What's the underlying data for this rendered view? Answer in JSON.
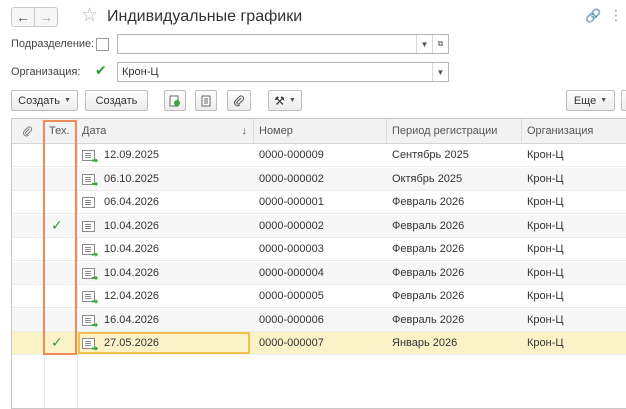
{
  "header": {
    "title": "Индивидуальные графики",
    "back_icon": "←",
    "forward_icon": "→",
    "star_icon": "☆",
    "link_icon": "🔗",
    "more_icon": "⋮"
  },
  "filters": {
    "department_label": "Подразделение:",
    "department_value": "",
    "organization_label": "Организация:",
    "organization_value": "Крон-Ц"
  },
  "toolbar": {
    "create_dropdown_label": "Создать",
    "create_button_label": "Создать",
    "more_label": "Еще"
  },
  "table": {
    "columns": [
      "Тех.",
      "Дата",
      "Номер",
      "Период регистрации",
      "Организация"
    ],
    "sort_indicator": "↓",
    "rows": [
      {
        "tech": "",
        "date": "12.09.2025",
        "number": "0000-000009",
        "period": "Сентябрь 2025",
        "org": "Крон-Ц",
        "posted": true
      },
      {
        "tech": "",
        "date": "06.10.2025",
        "number": "0000-000002",
        "period": "Октябрь 2025",
        "org": "Крон-Ц",
        "posted": true
      },
      {
        "tech": "",
        "date": "06.04.2026",
        "number": "0000-000001",
        "period": "Февраль 2026",
        "org": "Крон-Ц",
        "posted": false
      },
      {
        "tech": "✓",
        "date": "10.04.2026",
        "number": "0000-000002",
        "period": "Февраль 2026",
        "org": "Крон-Ц",
        "posted": false
      },
      {
        "tech": "",
        "date": "10.04.2026",
        "number": "0000-000003",
        "period": "Февраль 2026",
        "org": "Крон-Ц",
        "posted": true
      },
      {
        "tech": "",
        "date": "10.04.2026",
        "number": "0000-000004",
        "period": "Февраль 2026",
        "org": "Крон-Ц",
        "posted": true
      },
      {
        "tech": "",
        "date": "12.04.2026",
        "number": "0000-000005",
        "period": "Февраль 2026",
        "org": "Крон-Ц",
        "posted": true
      },
      {
        "tech": "",
        "date": "16.04.2026",
        "number": "0000-000006",
        "period": "Февраль 2026",
        "org": "Крон-Ц",
        "posted": true
      },
      {
        "tech": "✓",
        "date": "27.05.2026",
        "number": "0000-000007",
        "period": "Январь 2026",
        "org": "Крон-Ц",
        "posted": true,
        "selected": true
      }
    ]
  },
  "colors": {
    "check_green": "#2e9a3a",
    "selection": "#fbf2c8",
    "highlight_orange": "#f08a5a"
  }
}
